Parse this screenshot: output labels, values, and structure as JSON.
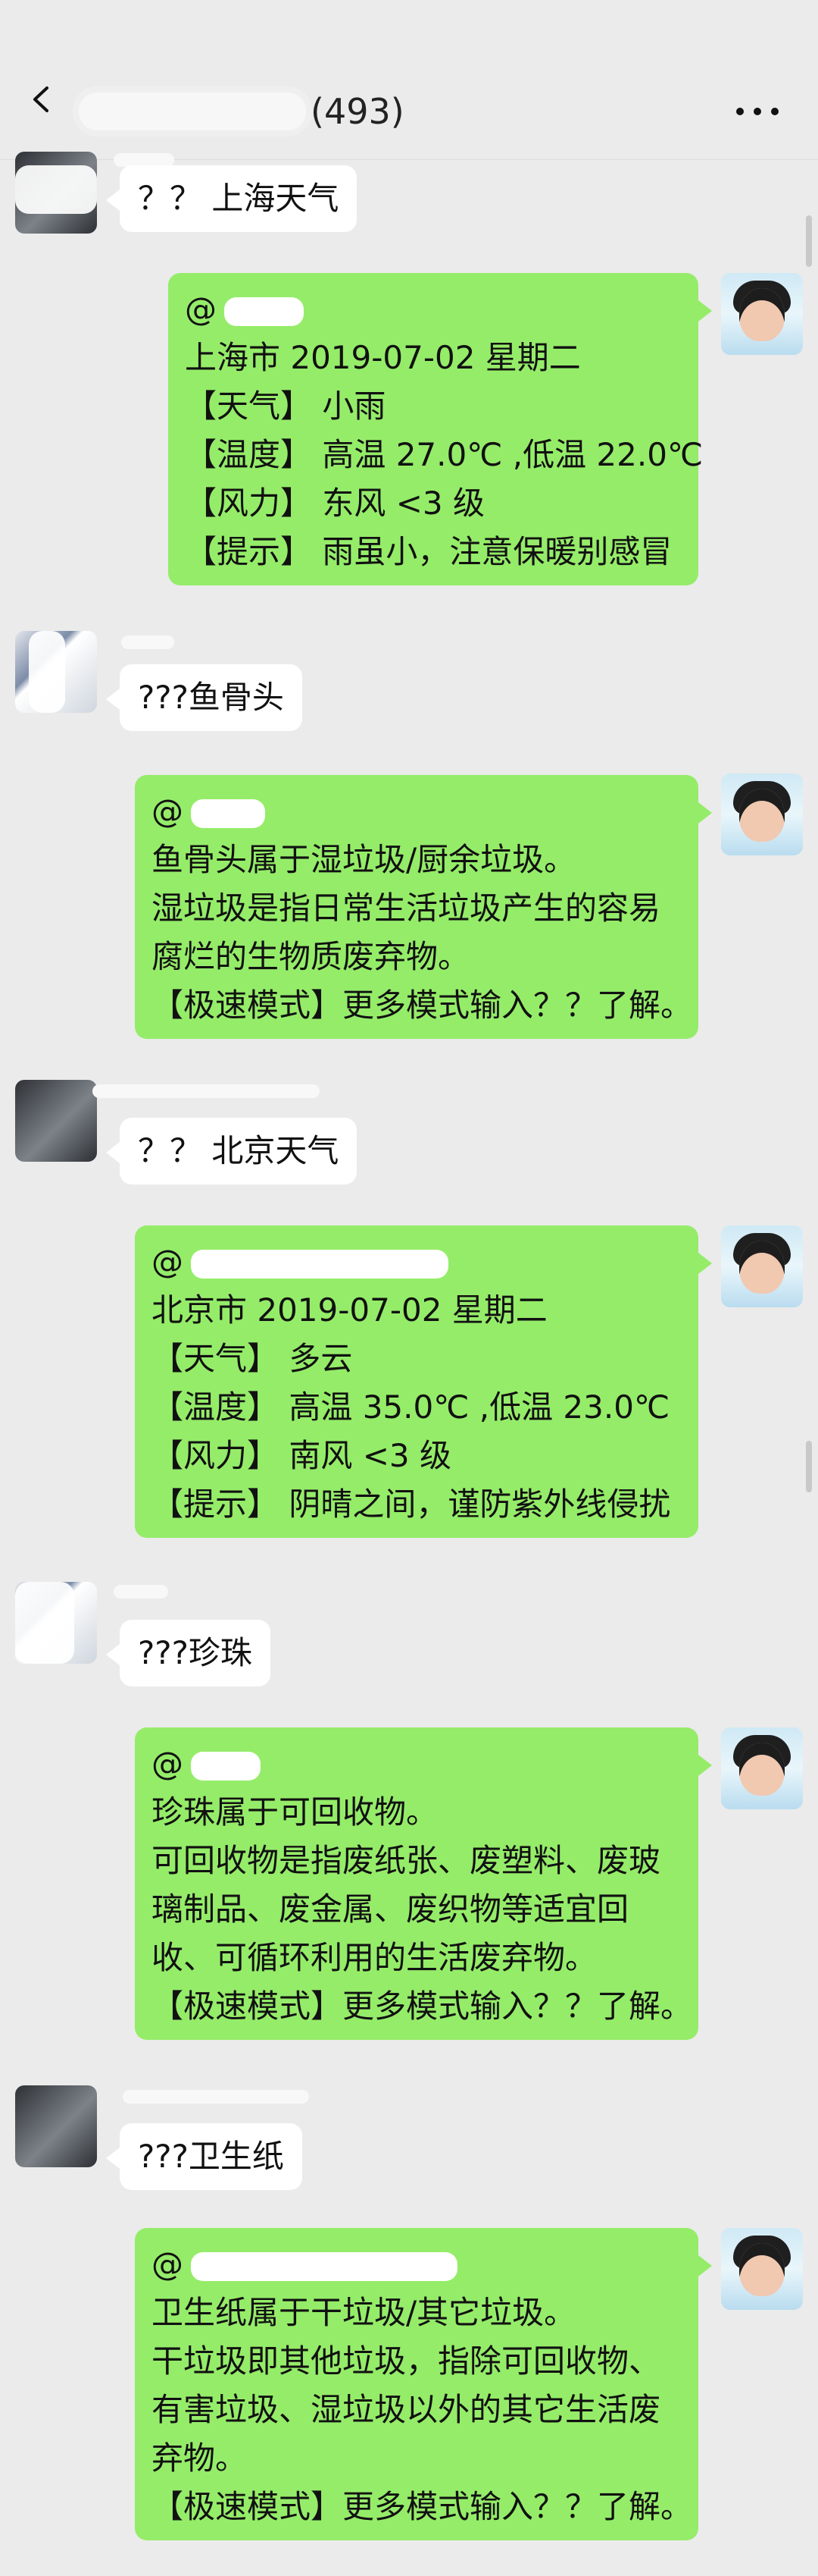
{
  "header": {
    "title_count": "(493)",
    "back_icon": "chevron-left-icon",
    "more_icon": "more-icon"
  },
  "messages": {
    "m1": {
      "text": "？？ 上海天气"
    },
    "m2": {
      "mention": "@",
      "lines": [
        "上海市 2019-07-02 星期二",
        "【天气】 小雨",
        "【温度】 高温 27.0℃ ,低温 22.0℃",
        "【风力】 东风 <3 级",
        "【提示】 雨虽小，注意保暖别感冒"
      ]
    },
    "m3": {
      "text": "???鱼骨头"
    },
    "m4": {
      "mention": "@",
      "lines": [
        "鱼骨头属于湿垃圾/厨余垃圾。",
        "湿垃圾是指日常生活垃圾产生的容易",
        "腐烂的生物质废弃物。",
        "【极速模式】更多模式输入？？了解。"
      ]
    },
    "m5": {
      "text": "？？ 北京天气"
    },
    "m6": {
      "mention": "@",
      "lines": [
        "北京市 2019-07-02 星期二",
        "【天气】 多云",
        "【温度】 高温 35.0℃ ,低温 23.0℃",
        "【风力】 南风 <3 级",
        "【提示】 阴晴之间，谨防紫外线侵扰"
      ]
    },
    "m7": {
      "text": "???珍珠"
    },
    "m8": {
      "mention": "@",
      "lines": [
        "珍珠属于可回收物。",
        "可回收物是指废纸张、废塑料、废玻",
        "璃制品、废金属、废织物等适宜回",
        "收、可循环利用的生活废弃物。",
        "【极速模式】更多模式输入？？了解。"
      ]
    },
    "m9": {
      "text": "???卫生纸"
    },
    "m10": {
      "mention": "@",
      "lines": [
        "卫生纸属于干垃圾/其它垃圾。",
        "干垃圾即其他垃圾，指除可回收物、",
        "有害垃圾、湿垃圾以外的其它生活废",
        "弃物。",
        "【极速模式】更多模式输入？？了解。"
      ]
    }
  },
  "colors": {
    "background": "#ebebeb",
    "incoming_bubble": "#ffffff",
    "outgoing_bubble": "#95ec69"
  }
}
